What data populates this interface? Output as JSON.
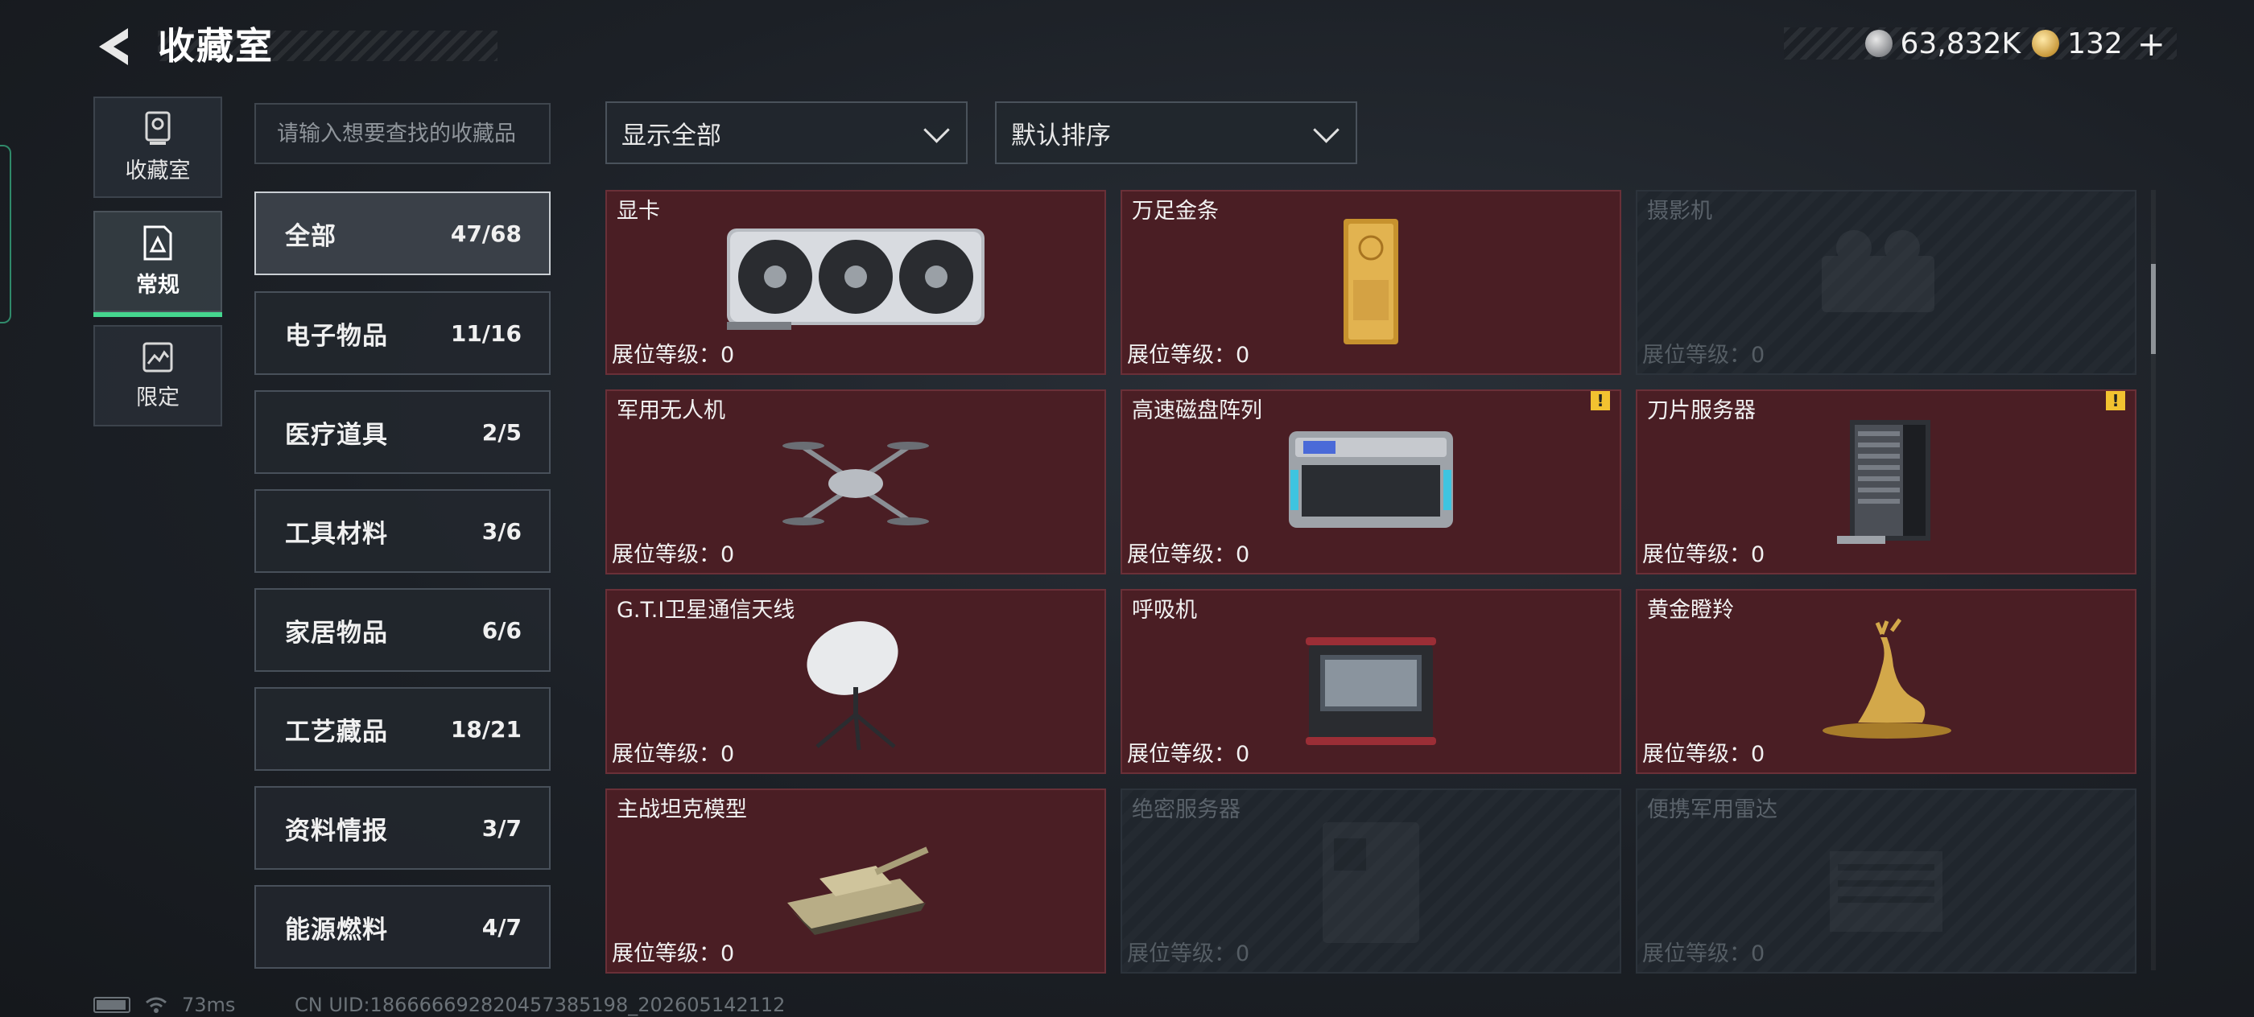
{
  "header": {
    "title": "收藏室",
    "currency_silver": "63,832K",
    "currency_gold": "132",
    "plus_label": "+"
  },
  "nav_tabs": [
    {
      "label": "收藏室",
      "icon": "trophy-icon",
      "active": false
    },
    {
      "label": "常规",
      "icon": "document-icon",
      "active": true
    },
    {
      "label": "限定",
      "icon": "frame-icon",
      "active": false
    }
  ],
  "search": {
    "placeholder": "请输入想要查找的收藏品"
  },
  "categories": [
    {
      "name": "全部",
      "count": "47/68",
      "active": true
    },
    {
      "name": "电子物品",
      "count": "11/16"
    },
    {
      "name": "医疗道具",
      "count": "2/5"
    },
    {
      "name": "工具材料",
      "count": "3/6"
    },
    {
      "name": "家居物品",
      "count": "6/6"
    },
    {
      "name": "工艺藏品",
      "count": "18/21"
    },
    {
      "name": "资料情报",
      "count": "3/7"
    },
    {
      "name": "能源燃料",
      "count": "4/7"
    }
  ],
  "filters": {
    "display": "显示全部",
    "sort": "默认排序"
  },
  "items": [
    {
      "name": "显卡",
      "level": "展位等级：0",
      "collected": true,
      "icon": "graphics-card-icon"
    },
    {
      "name": "万足金条",
      "level": "展位等级：0",
      "collected": true,
      "icon": "gold-bar-icon"
    },
    {
      "name": "摄影机",
      "level": "展位等级：0",
      "collected": false,
      "icon": "camera-icon"
    },
    {
      "name": "军用无人机",
      "level": "展位等级：0",
      "collected": true,
      "icon": "drone-icon"
    },
    {
      "name": "高速磁盘阵列",
      "level": "展位等级：0",
      "collected": true,
      "warning": true,
      "icon": "disk-array-icon"
    },
    {
      "name": "刀片服务器",
      "level": "展位等级：0",
      "collected": true,
      "warning": true,
      "icon": "blade-server-icon"
    },
    {
      "name": "G.T.I卫星通信天线",
      "level": "展位等级：0",
      "collected": true,
      "icon": "satellite-antenna-icon"
    },
    {
      "name": "呼吸机",
      "level": "展位等级：0",
      "collected": true,
      "icon": "ventilator-icon"
    },
    {
      "name": "黄金瞪羚",
      "level": "展位等级：0",
      "collected": true,
      "icon": "gold-gazelle-icon"
    },
    {
      "name": "主战坦克模型",
      "level": "展位等级：0",
      "collected": true,
      "icon": "tank-model-icon"
    },
    {
      "name": "绝密服务器",
      "level": "展位等级：0",
      "collected": false,
      "icon": "secret-server-icon"
    },
    {
      "name": "便携军用雷达",
      "level": "展位等级：0",
      "collected": false,
      "icon": "radar-icon"
    }
  ],
  "warning_mark": "!",
  "status": {
    "ping": "73ms",
    "uid": "CN UID:18666669282045738519​8_202605142112"
  },
  "colors": {
    "collected_card": "#4a1e24",
    "locked_card": "#20262d",
    "accent_green": "#45d68f",
    "warning_yellow": "#f2c230"
  }
}
